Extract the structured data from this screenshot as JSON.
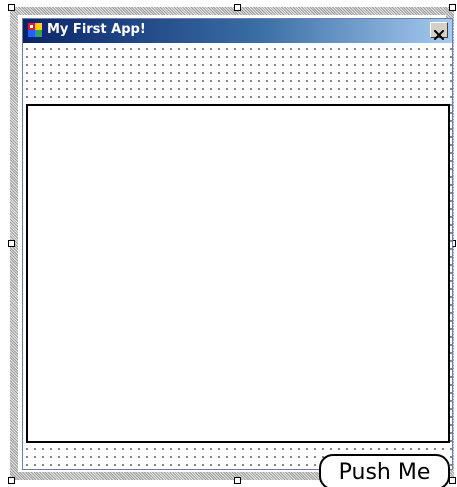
{
  "window": {
    "title": "My First App!",
    "close_symbol": "×"
  },
  "form": {
    "text_box_value": "",
    "push_button_label": "Push Me"
  },
  "icons": {
    "app_icon": "app-icon",
    "close_icon": "close-icon"
  },
  "colors": {
    "title_bar_start": "#0a246a",
    "title_bar_end": "#a6caf0",
    "title_text": "#ffffff",
    "surface_dot": "#000000",
    "border": "#000000"
  }
}
